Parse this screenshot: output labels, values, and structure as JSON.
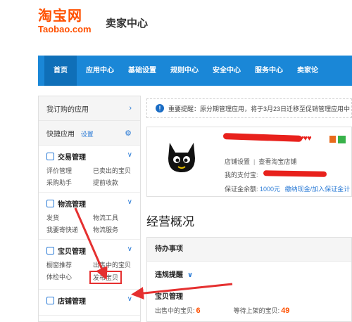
{
  "header": {
    "logo_cn": "淘宝网",
    "logo_en": "Taobao.com",
    "title": "卖家中心"
  },
  "nav": {
    "items": [
      "首页",
      "应用中心",
      "基础设置",
      "规则中心",
      "安全中心",
      "服务中心",
      "卖家论"
    ]
  },
  "sidebar": {
    "subscribed": "我订购的应用",
    "quick": "快捷应用",
    "quick_settings": "设置",
    "groups": [
      {
        "title": "交易管理",
        "links": [
          "评价管理",
          "已卖出的宝贝",
          "采购助手",
          "提前收款"
        ]
      },
      {
        "title": "物流管理",
        "links": [
          "发货",
          "物流工具",
          "我要寄快递",
          "物流服务"
        ]
      },
      {
        "title": "宝贝管理",
        "links": [
          "橱窗推荐",
          "出售中的宝贝",
          "体检中心",
          "发布宝贝"
        ]
      },
      {
        "title": "店铺管理",
        "links": []
      }
    ]
  },
  "notice": {
    "text": "重要提醒：原分期管理应用，将于3月23日迁移至促销管理应用中"
  },
  "profile": {
    "shop_settings": "店铺设置",
    "view_shop": "查看淘宝店铺",
    "alipay_label": "我的支付宝:",
    "deposit_label": "保证金余额:",
    "deposit_amount": "1000元",
    "deposit_link": "缴纳现金/加入保证金计"
  },
  "overview": {
    "title": "经营概况",
    "todo_title": "待办事项",
    "violation": "违规提醒",
    "sub_title": "宝贝管理",
    "on_sale_label": "出售中的宝贝:",
    "on_sale_count": "6",
    "pending_label": "等待上架的宝贝:",
    "pending_count": "49"
  },
  "colors": {
    "brand": "#ff5000",
    "nav": "#1a87d7",
    "link": "#2b7bd6",
    "annotation": "#e53030"
  }
}
